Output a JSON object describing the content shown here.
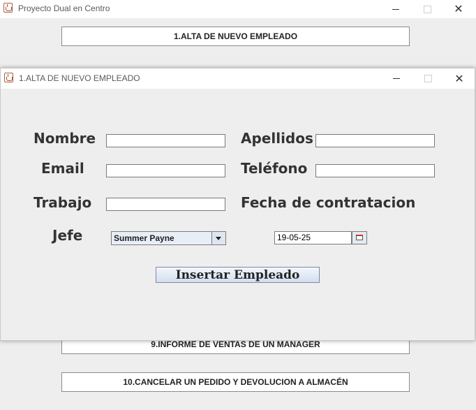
{
  "main_window": {
    "title": "Proyecto Dual en Centro",
    "buttons": [
      "1.ALTA DE NUEVO EMPLEADO",
      "9.INFORME DE VENTAS DE UN MANAGER",
      "10.CANCELAR UN PEDIDO Y DEVOLUCION A ALMACÉN"
    ]
  },
  "dialog": {
    "title": "1.ALTA DE NUEVO EMPLEADO",
    "labels": {
      "nombre": "Nombre",
      "apellidos": "Apellidos",
      "email": "Email",
      "telefono": "Teléfono",
      "trabajo": "Trabajo",
      "fecha": "Fecha de contratacion",
      "jefe": "Jefe"
    },
    "jefe_selected": "Summer Payne",
    "fecha_value": "19-05-25",
    "submit_label": "Insertar Empleado"
  },
  "icons": {
    "app": "java-cup-icon",
    "minimize": "minimize-icon",
    "maximize": "maximize-icon",
    "close": "close-icon",
    "dropdown": "chevron-down-icon",
    "calendar": "calendar-icon"
  }
}
